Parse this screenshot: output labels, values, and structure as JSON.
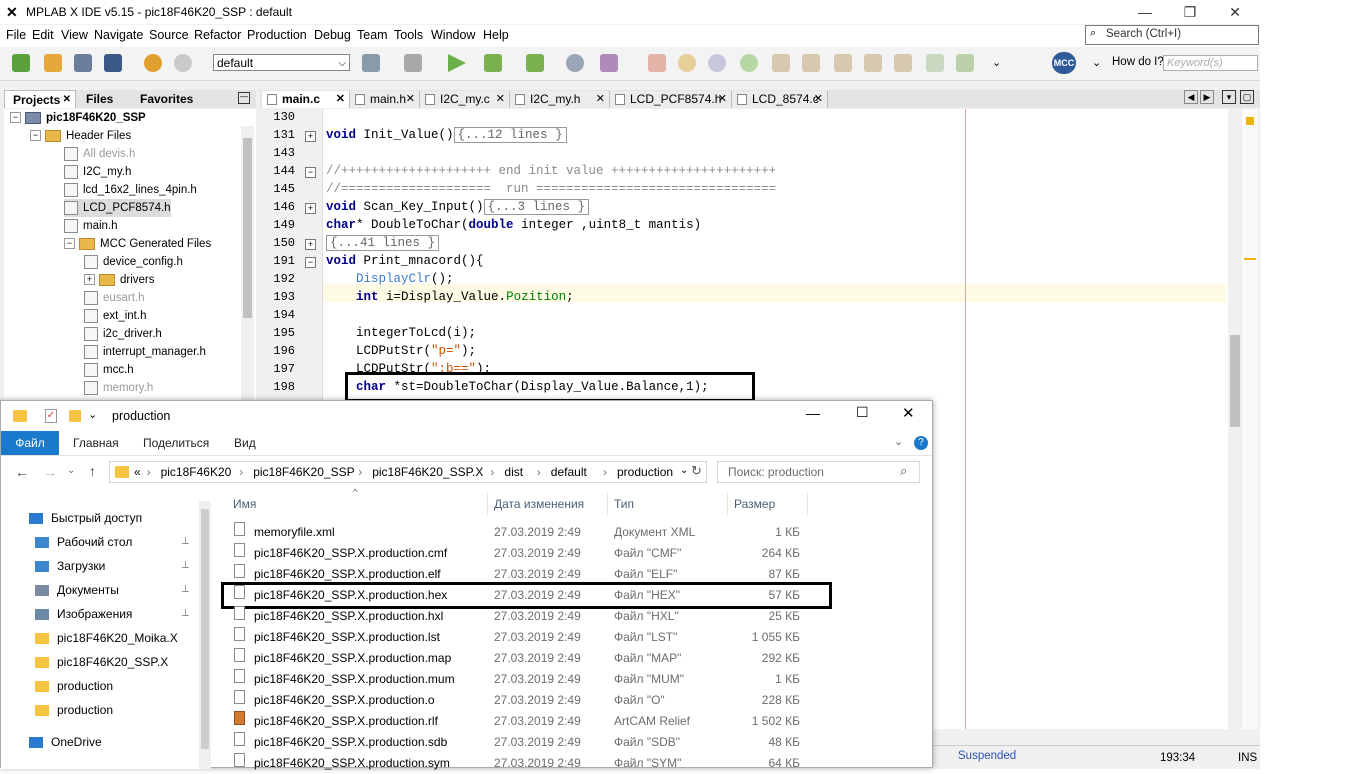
{
  "ide": {
    "title": "MPLAB X IDE v5.15 - pic18F46K20_SSP : default",
    "menu": [
      "File",
      "Edit",
      "View",
      "Navigate",
      "Source",
      "Refactor",
      "Production",
      "Debug",
      "Team",
      "Tools",
      "Window",
      "Help"
    ],
    "search_placeholder": "Search (Ctrl+I)",
    "config": "default",
    "mcc": "MCC",
    "how_do_i": "How do I?",
    "keywords_placeholder": "Keyword(s)",
    "panel_tabs": [
      "Projects",
      "Files",
      "Favorites"
    ],
    "tree": [
      {
        "label": "pic18F46K20_SSP",
        "level": 0,
        "type": "project",
        "bold": true
      },
      {
        "label": "Header Files",
        "level": 1,
        "type": "folder"
      },
      {
        "label": "All devis.h",
        "level": 2,
        "type": "file",
        "grey": true
      },
      {
        "label": "I2C_my.h",
        "level": 2,
        "type": "file"
      },
      {
        "label": "lcd_16x2_lines_4pin.h",
        "level": 2,
        "type": "file"
      },
      {
        "label": "LCD_PCF8574.h",
        "level": 2,
        "type": "file",
        "selected": true
      },
      {
        "label": "main.h",
        "level": 2,
        "type": "file"
      },
      {
        "label": "MCC Generated Files",
        "level": 2,
        "type": "folder"
      },
      {
        "label": "device_config.h",
        "level": 3,
        "type": "file"
      },
      {
        "label": "drivers",
        "level": 3,
        "type": "folder"
      },
      {
        "label": "eusart.h",
        "level": 3,
        "type": "file",
        "grey": true
      },
      {
        "label": "ext_int.h",
        "level": 3,
        "type": "file"
      },
      {
        "label": "i2c_driver.h",
        "level": 3,
        "type": "file"
      },
      {
        "label": "interrupt_manager.h",
        "level": 3,
        "type": "file"
      },
      {
        "label": "mcc.h",
        "level": 3,
        "type": "file"
      },
      {
        "label": "memory.h",
        "level": 3,
        "type": "file",
        "grey": true
      }
    ],
    "editor_tabs": [
      {
        "label": "main.c",
        "active": true
      },
      {
        "label": "main.h"
      },
      {
        "label": "I2C_my.c"
      },
      {
        "label": "I2C_my.h"
      },
      {
        "label": "LCD_PCF8574.h"
      },
      {
        "label": "LCD_8574.c"
      }
    ],
    "code_lines": [
      {
        "n": "130",
        "fold": "",
        "html": ""
      },
      {
        "n": "131",
        "fold": "+",
        "html": "<span class='kw'>void</span> Init_Value()<span class='foldbox'>{...12 lines }</span>"
      },
      {
        "n": "143",
        "fold": "",
        "html": ""
      },
      {
        "n": "144",
        "fold": "-",
        "html": "<span class='cm'>//++++++++++++++++++++ end init value ++++++++++++++++++++++</span>"
      },
      {
        "n": "145",
        "fold": "",
        "html": "<span class='cm'>//====================  run ================================</span>"
      },
      {
        "n": "146",
        "fold": "+",
        "html": "<span class='kw'>void</span> Scan_Key_Input()<span class='foldbox'>{...3 lines }</span>"
      },
      {
        "n": "149",
        "fold": "",
        "html": "<span class='kw'>char</span>* DoubleToChar(<span class='kw'>double</span> integer ,uint8_t mantis)"
      },
      {
        "n": "150",
        "fold": "+",
        "html": "<span class='foldbox'>{...41 lines }</span>"
      },
      {
        "n": "191",
        "fold": "-",
        "html": "<span class='kw'>void</span> Print_mnacord(){"
      },
      {
        "n": "192",
        "fold": "",
        "html": "    <span class='fn'>DisplayClr</span>();"
      },
      {
        "n": "193",
        "fold": "",
        "html": "    <span class='kw'>int</span> i=Display_Value.<span class='fd'>Pozition</span>;",
        "hl": true
      },
      {
        "n": "194",
        "fold": "",
        "html": ""
      },
      {
        "n": "195",
        "fold": "",
        "html": "    integerToLcd(i);"
      },
      {
        "n": "196",
        "fold": "",
        "html": "    LCDPutStr(<span class='st'>\"p=\"</span>);"
      },
      {
        "n": "197",
        "fold": "",
        "html": "    LCDPutStr(<span class='st'>\";b==\"</span>);"
      },
      {
        "n": "198",
        "fold": "",
        "html": "    <span class='kw'>char</span> *st=DoubleToChar(Display_Value.Balance,1);"
      }
    ],
    "status": {
      "state": "Suspended",
      "position": "193:34",
      "mode": "INS"
    }
  },
  "explorer": {
    "title": "production",
    "ribbon": [
      "Файл",
      "Главная",
      "Поделиться",
      "Вид"
    ],
    "path": [
      "«",
      "pic18F46K20",
      "pic18F46K20_SSP",
      "pic18F46K20_SSP.X",
      "dist",
      "default",
      "production"
    ],
    "search_placeholder": "Поиск: production",
    "nav": [
      {
        "label": "Быстрый доступ",
        "type": "star"
      },
      {
        "label": "Рабочий стол",
        "type": "desktop",
        "pin": true
      },
      {
        "label": "Загрузки",
        "type": "download",
        "pin": true
      },
      {
        "label": "Документы",
        "type": "docs",
        "pin": true
      },
      {
        "label": "Изображения",
        "type": "images",
        "pin": true
      },
      {
        "label": "pic18F46K20_Moika.X",
        "type": "folder"
      },
      {
        "label": "pic18F46K20_SSP.X",
        "type": "folder"
      },
      {
        "label": "production",
        "type": "folder"
      },
      {
        "label": "production",
        "type": "folder"
      },
      {
        "label": "OneDrive",
        "type": "cloud"
      }
    ],
    "columns": [
      "Имя",
      "Дата изменения",
      "Тип",
      "Размер"
    ],
    "files": [
      {
        "name": "memoryfile.xml",
        "date": "27.03.2019 2:49",
        "type": "Документ XML",
        "size": "1 КБ"
      },
      {
        "name": "pic18F46K20_SSP.X.production.cmf",
        "date": "27.03.2019 2:49",
        "type": "Файл \"CMF\"",
        "size": "264 КБ"
      },
      {
        "name": "pic18F46K20_SSP.X.production.elf",
        "date": "27.03.2019 2:49",
        "type": "Файл \"ELF\"",
        "size": "87 КБ"
      },
      {
        "name": "pic18F46K20_SSP.X.production.hex",
        "date": "27.03.2019 2:49",
        "type": "Файл \"HEX\"",
        "size": "57 КБ",
        "boxed": true
      },
      {
        "name": "pic18F46K20_SSP.X.production.hxl",
        "date": "27.03.2019 2:49",
        "type": "Файл \"HXL\"",
        "size": "25 КБ"
      },
      {
        "name": "pic18F46K20_SSP.X.production.lst",
        "date": "27.03.2019 2:49",
        "type": "Файл \"LST\"",
        "size": "1 055 КБ"
      },
      {
        "name": "pic18F46K20_SSP.X.production.map",
        "date": "27.03.2019 2:49",
        "type": "Файл \"MAP\"",
        "size": "292 КБ"
      },
      {
        "name": "pic18F46K20_SSP.X.production.mum",
        "date": "27.03.2019 2:49",
        "type": "Файл \"MUM\"",
        "size": "1 КБ"
      },
      {
        "name": "pic18F46K20_SSP.X.production.o",
        "date": "27.03.2019 2:49",
        "type": "Файл \"O\"",
        "size": "228 КБ"
      },
      {
        "name": "pic18F46K20_SSP.X.production.rlf",
        "date": "27.03.2019 2:49",
        "type": "ArtCAM Relief",
        "size": "1 502 КБ"
      },
      {
        "name": "pic18F46K20_SSP.X.production.sdb",
        "date": "27.03.2019 2:49",
        "type": "Файл \"SDB\"",
        "size": "48 КБ"
      },
      {
        "name": "pic18F46K20_SSP.X.production.sym",
        "date": "27.03.2019 2:49",
        "type": "Файл \"SYM\"",
        "size": "64 КБ"
      }
    ]
  }
}
